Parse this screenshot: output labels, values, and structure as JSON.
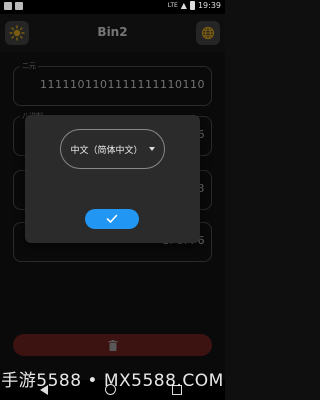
{
  "status_bar": {
    "network": "LTE",
    "time": "19:39"
  },
  "app_bar": {
    "title": "Bin2",
    "left_icon": "sun-icon",
    "right_icon": "globe-icon"
  },
  "fields": [
    {
      "label": "二元",
      "value": "1111101101111111110110"
    },
    {
      "label": "八进制",
      "value": "7667766"
    },
    {
      "label": "",
      "value": "3"
    },
    {
      "label": "",
      "value": "1F6FF6"
    }
  ],
  "delete_button": {
    "icon": "trash-icon"
  },
  "dialog": {
    "language_selected": "中文（简体中文）",
    "confirm_icon": "check-icon"
  },
  "watermark": "手游5588 • MX5588.COM",
  "colors": {
    "accent": "#2196f3",
    "danger": "#7a2622",
    "background": "#141414"
  }
}
